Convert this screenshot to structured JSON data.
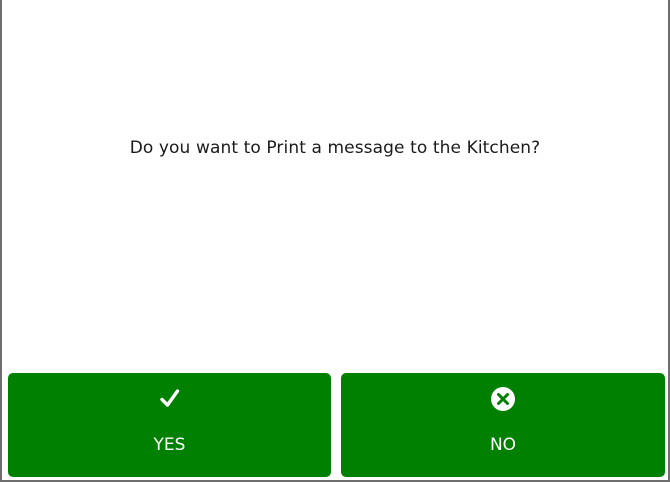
{
  "dialog": {
    "message": "Do you want to Print a message to the Kitchen?",
    "yes_label": "YES",
    "no_label": "NO"
  },
  "colors": {
    "button_background": "#008000",
    "button_text": "#ffffff",
    "message_text": "#1a1a1a"
  },
  "icons": {
    "yes": "checkmark-icon",
    "no": "close-circle-icon"
  }
}
